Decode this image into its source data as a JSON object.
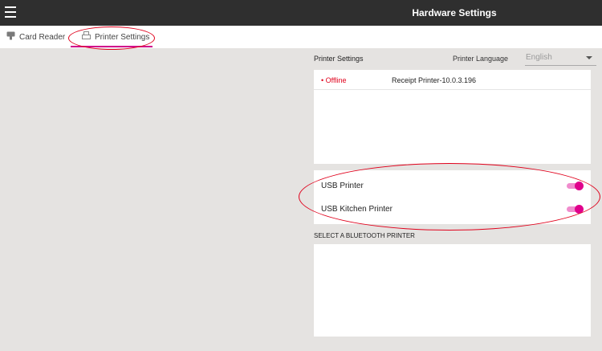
{
  "header": {
    "title": "Hardware Settings"
  },
  "tabs": [
    {
      "label": "Card Reader",
      "icon": "card-reader-icon"
    },
    {
      "label": "Printer Settings",
      "icon": "printer-icon",
      "active": true
    }
  ],
  "printer_settings": {
    "title": "Printer Settings",
    "language_label": "Printer Language",
    "language_value": "English",
    "printers": [
      {
        "status": "• Offline",
        "name": "Receipt Printer-10.0.3.196"
      }
    ],
    "toggles": [
      {
        "label": "USB Printer",
        "on": true
      },
      {
        "label": "USB Kitchen Printer",
        "on": true
      }
    ],
    "bluetooth_label": "SELECT A BLUETOOTH PRINTER"
  },
  "colors": {
    "accent": "#d0008c",
    "offline": "#e0001b",
    "annotation": "#e0001b",
    "topbar": "#2f2f2f",
    "background": "#e5e3e1"
  }
}
